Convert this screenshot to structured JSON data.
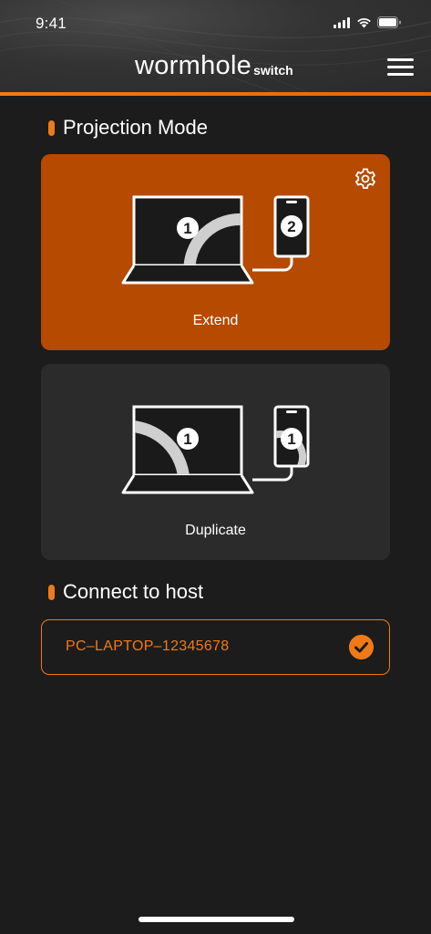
{
  "status_bar": {
    "time": "9:41"
  },
  "header": {
    "logo_main": "wormhole",
    "logo_sub": "switch",
    "menu_icon": "hamburger-menu-icon"
  },
  "projection": {
    "title": "Projection Mode",
    "modes": [
      {
        "label": "Extend",
        "selected": true,
        "laptop_badge": "1",
        "phone_badge": "2"
      },
      {
        "label": "Duplicate",
        "selected": false,
        "laptop_badge": "1",
        "phone_badge": "1"
      }
    ]
  },
  "connect": {
    "title": "Connect to host",
    "host": {
      "name": "PC–LAPTOP–12345678",
      "selected": true
    }
  },
  "colors": {
    "accent": "#f07a17",
    "selected_card": "#b54a00",
    "card": "#2b2b2b",
    "background": "#1c1c1c"
  }
}
